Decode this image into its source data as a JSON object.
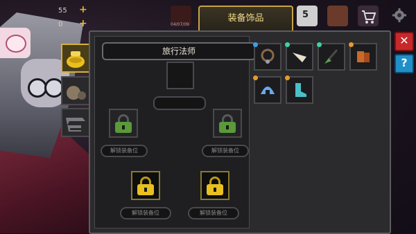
{
  "header": {
    "active_tab": "装备饰品",
    "coins_value": "55",
    "gems_value": "0",
    "small_counter": "04/07/09",
    "badge_counter": "5"
  },
  "panel": {
    "title": "旅行法师",
    "slots": [
      {
        "label": "解锁装备位",
        "lock": "green-lock-icon"
      },
      {
        "label": "解锁装备位",
        "lock": "green-lock-icon"
      },
      {
        "label": "解锁装备位",
        "lock": "gold-lock-icon"
      },
      {
        "label": "解锁装备位",
        "lock": "gold-lock-icon"
      }
    ]
  },
  "side_tabs": [
    {
      "name": "gold-pot-icon",
      "active": true
    },
    {
      "name": "sack-icon",
      "active": false
    },
    {
      "name": "anvil-icon",
      "active": false
    }
  ],
  "inventory": [
    {
      "name": "necklace-item",
      "dot": "#3aa0e8"
    },
    {
      "name": "horn-item",
      "dot": "#3ad6a0"
    },
    {
      "name": "broom-item",
      "dot": "#3ad6a0"
    },
    {
      "name": "scroll-item",
      "dot": "#e89a2a"
    },
    {
      "name": "helmet-item",
      "dot": "#e89a2a"
    },
    {
      "name": "boot-item",
      "dot": "#e89a2a"
    }
  ],
  "buttons": {
    "close": "✕",
    "help": "?"
  },
  "colors": {
    "accent_gold": "#d6b23c",
    "close_red": "#c8282a",
    "help_blue": "#1f8fc8",
    "lock_green": "#5a9a3a",
    "lock_gold": "#e8c020"
  }
}
